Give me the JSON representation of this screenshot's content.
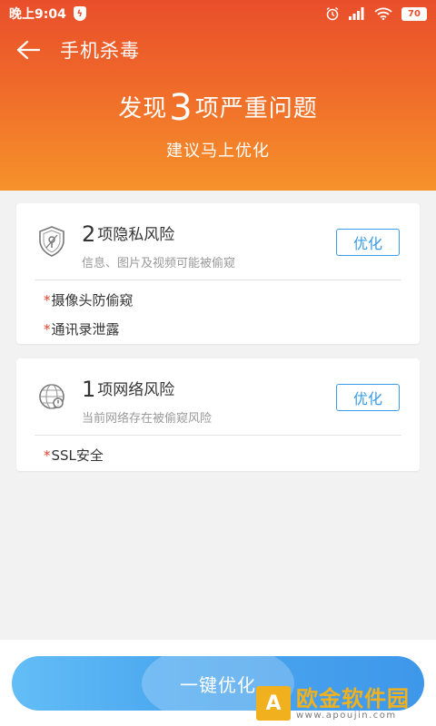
{
  "status_bar": {
    "time": "晚上9:04",
    "shield_symbol": "ϟ",
    "battery": "70",
    "icons": [
      "alarm-icon",
      "signal-icon",
      "wifi-icon",
      "battery-icon"
    ]
  },
  "nav": {
    "title": "手机杀毒"
  },
  "summary": {
    "prefix": "发现",
    "count": "3",
    "suffix": "项严重问题",
    "sub": "建议马上优化"
  },
  "cards": [
    {
      "count": "2",
      "title": "项隐私风险",
      "desc": "信息、图片及视频可能被偷窥",
      "button": "优化",
      "icon": "privacy-shield-icon",
      "items": [
        "摄像头防偷窥",
        "通讯录泄露"
      ]
    },
    {
      "count": "1",
      "title": "项网络风险",
      "desc": "当前网络存在被偷窥风险",
      "button": "优化",
      "icon": "network-globe-icon",
      "items": [
        "SSL安全"
      ]
    }
  ],
  "star_mark": "*",
  "main_button": "一键优化",
  "watermark": {
    "logo_char": "A",
    "name": "欧金软件园",
    "url": "www.apoujin.com"
  },
  "colors": {
    "header_top": "#e94e2b",
    "header_bottom": "#f6922a",
    "accent_blue": "#3a9be8",
    "star_red": "#e8412a",
    "watermark_gold": "#f1b11e"
  }
}
